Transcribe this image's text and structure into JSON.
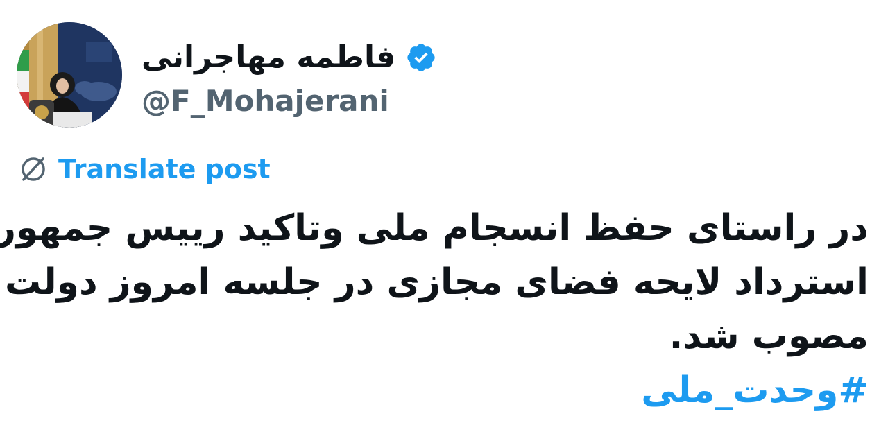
{
  "author": {
    "display_name": "فاطمه مهاجرانی",
    "handle": "@F_Mohajerani",
    "verified_icon": "verified-badge-icon",
    "avatar_icon": "avatar-photo"
  },
  "translate": {
    "icon": "globe-icon",
    "label": "Translate post"
  },
  "post": {
    "lines": [
      "در راستای حفظ انسجام ملی وتاکید رییس جمهور",
      "استرداد لایحه فضای مجازی در جلسه امروز دولت",
      "مصوب شد."
    ],
    "hashtag": "#وحدت_ملی"
  },
  "colors": {
    "accent": "#1d9bf0",
    "text": "#0f1419",
    "secondary": "#536471"
  }
}
